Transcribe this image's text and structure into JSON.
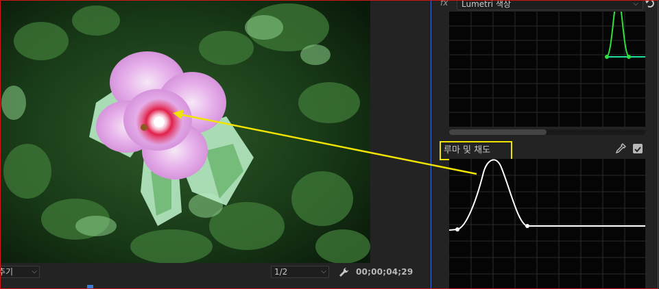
{
  "monitor": {
    "zoom_value": "맞추기",
    "zoom_visible": "추기",
    "resolution": "1/2",
    "timecode": "00;00;04;29"
  },
  "lumetri": {
    "fx_label": "fx",
    "effect_name": "Lumetri 색상",
    "section_title": "루마 및 채도"
  },
  "colors": {
    "highlight": "#f0e400",
    "curve_green": "#22dd44",
    "curve_white": "#ffffff",
    "accent": "#3a7bd5"
  },
  "icons": [
    "chevron-down-icon",
    "wrench-icon",
    "reset-icon",
    "eyedropper-icon",
    "checkbox-icon",
    "fx-icon"
  ]
}
